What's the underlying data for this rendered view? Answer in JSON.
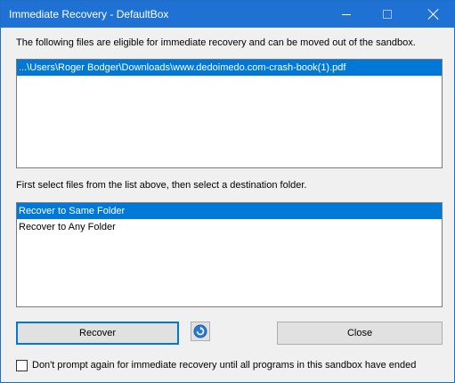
{
  "window": {
    "title": "Immediate Recovery - DefaultBox"
  },
  "files_section": {
    "label": "The following files are eligible for immediate recovery and can be moved out of the sandbox.",
    "files": [
      "...\\Users\\Roger Bodger\\Downloads\\www.dedoimedo.com-crash-book(1).pdf"
    ],
    "selected_index": 0
  },
  "destination_section": {
    "label": "First select files from the list above, then select a destination folder.",
    "options": [
      "Recover to Same Folder",
      "Recover to Any Folder"
    ],
    "selected_index": 0
  },
  "buttons": {
    "recover_label": "Recover",
    "close_label": "Close",
    "refresh_icon": "refresh-icon"
  },
  "checkbox": {
    "label": "Don't prompt again for immediate recovery until all programs in this sandbox have ended",
    "checked": false
  },
  "colors": {
    "titlebar": "#1f72d4",
    "selection": "#0078d7"
  }
}
